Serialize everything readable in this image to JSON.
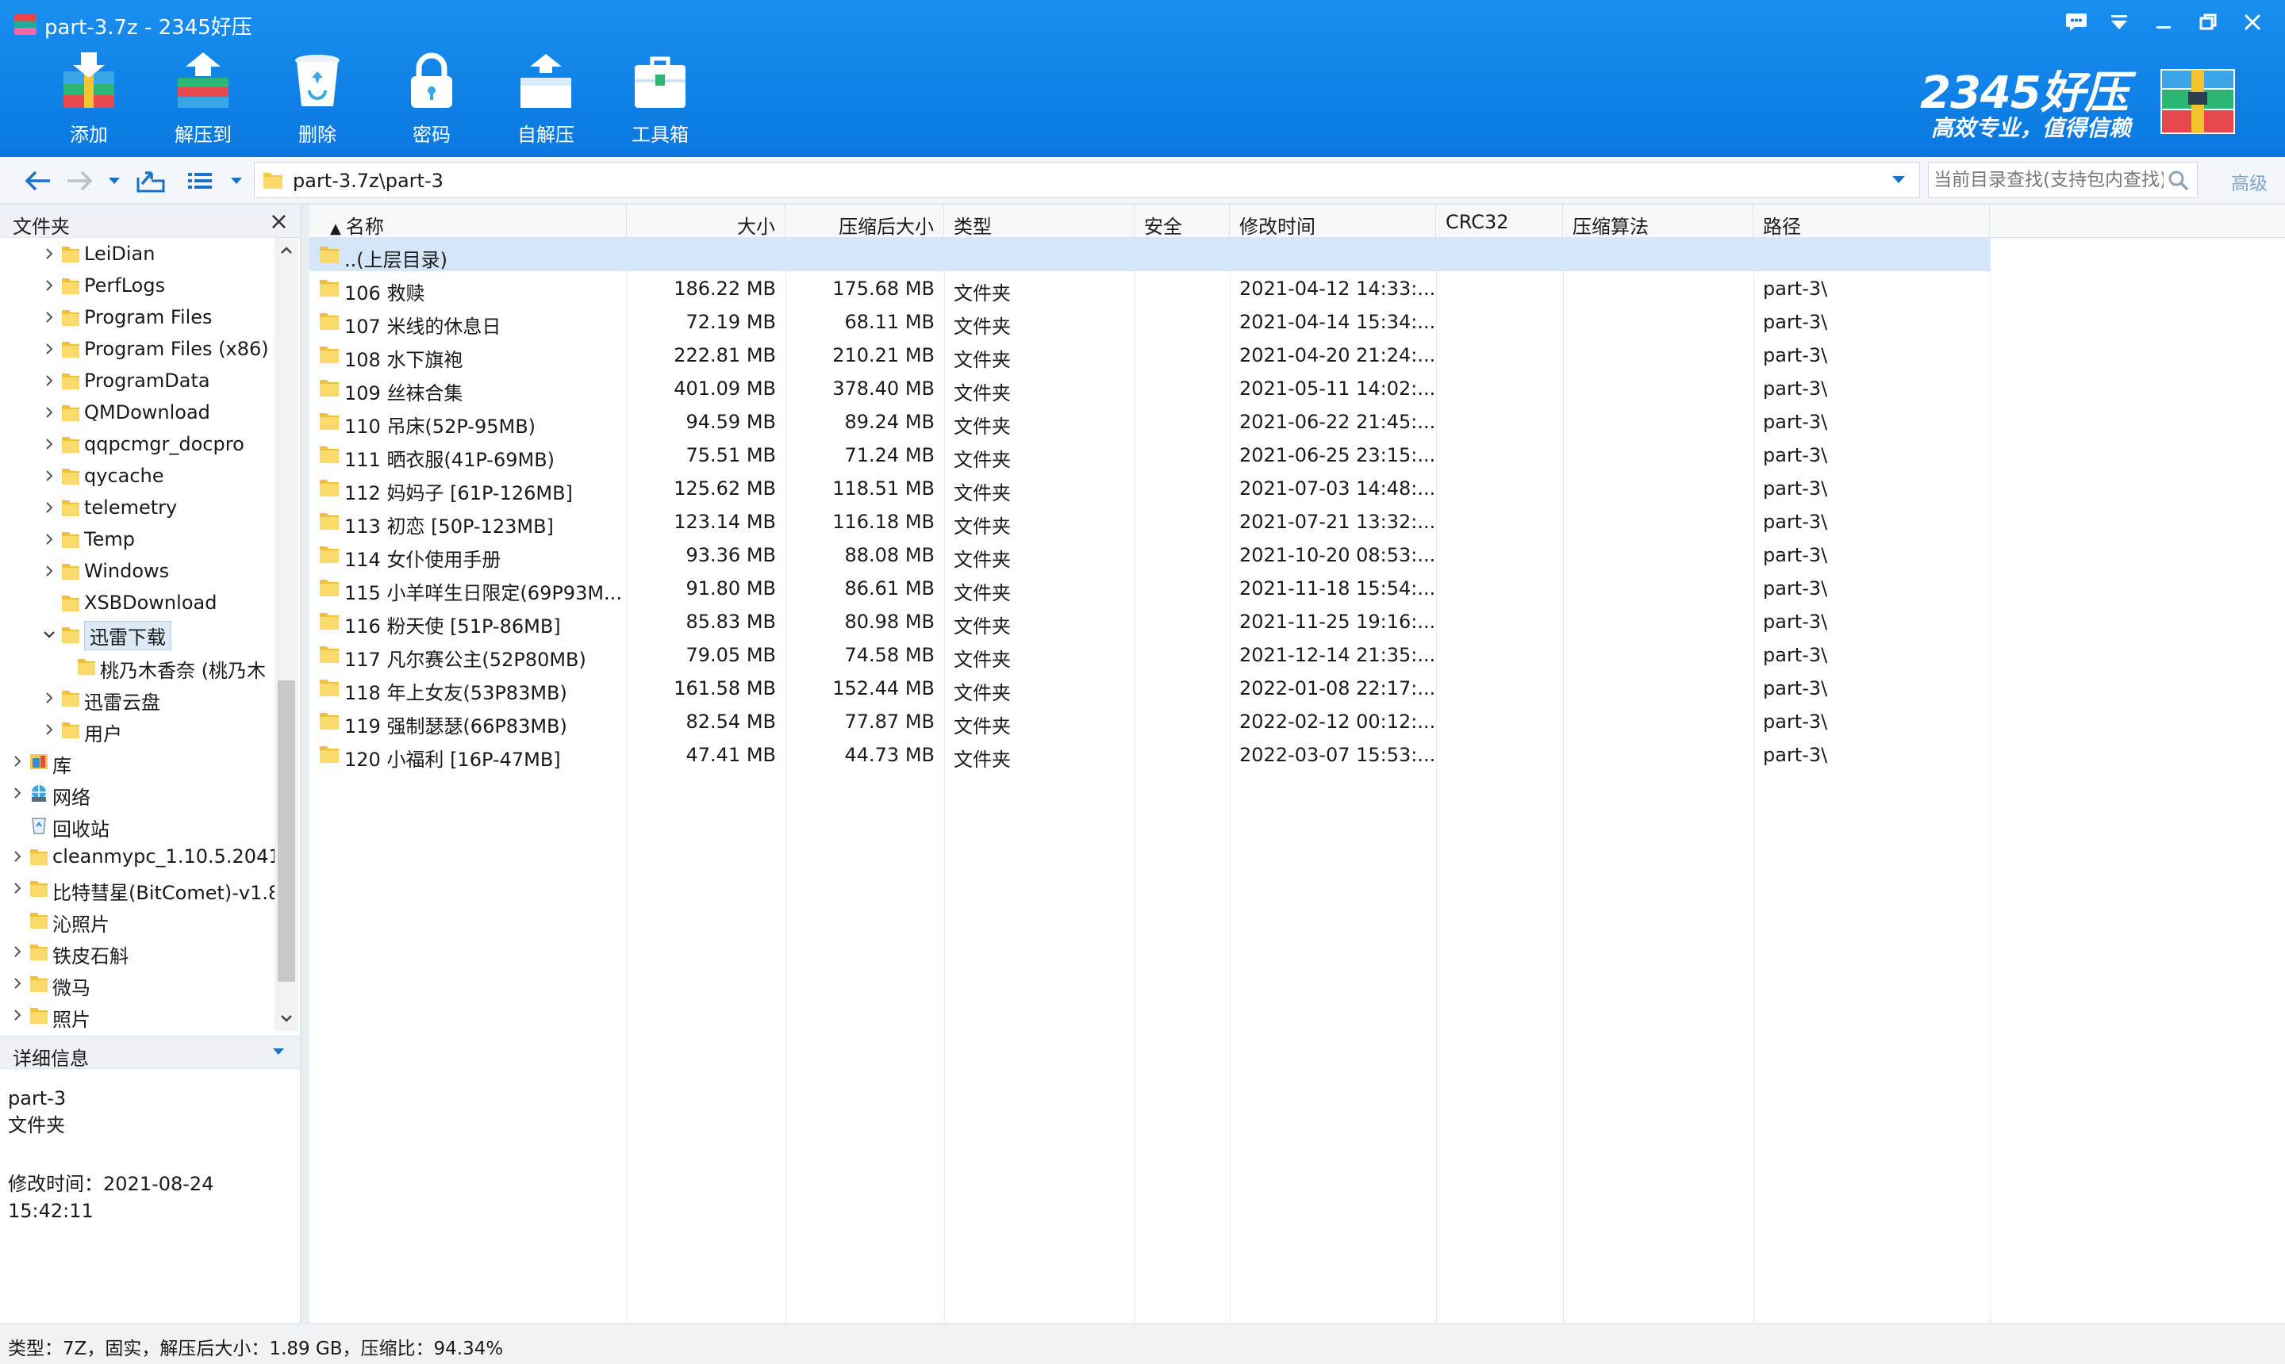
{
  "window": {
    "title": "part-3.7z - 2345好压"
  },
  "toolbar": {
    "buttons": [
      {
        "label": "添加",
        "icon": "add-archive-icon"
      },
      {
        "label": "解压到",
        "icon": "extract-to-icon"
      },
      {
        "label": "删除",
        "icon": "delete-bin-icon"
      },
      {
        "label": "密码",
        "icon": "padlock-icon"
      },
      {
        "label": "自解压",
        "icon": "self-extract-icon"
      },
      {
        "label": "工具箱",
        "icon": "toolbox-icon"
      }
    ]
  },
  "brand": {
    "name": "2345好压",
    "slogan": "高效专业，值得信赖"
  },
  "address": {
    "path": "part-3.7z\\part-3",
    "search_placeholder": "当前目录查找(支持包内查找)",
    "advanced_label": "高级"
  },
  "folder_pane": {
    "title": "文件夹",
    "close": "×",
    "tree": [
      {
        "label": "LeiDian",
        "level": 1,
        "expandable": true,
        "icon": "folder"
      },
      {
        "label": "PerfLogs",
        "level": 1,
        "expandable": true,
        "icon": "folder"
      },
      {
        "label": "Program Files",
        "level": 1,
        "expandable": true,
        "icon": "folder"
      },
      {
        "label": "Program Files (x86)",
        "level": 1,
        "expandable": true,
        "icon": "folder"
      },
      {
        "label": "ProgramData",
        "level": 1,
        "expandable": true,
        "icon": "folder"
      },
      {
        "label": "QMDownload",
        "level": 1,
        "expandable": true,
        "icon": "folder"
      },
      {
        "label": "qqpcmgr_docpro",
        "level": 1,
        "expandable": true,
        "icon": "folder"
      },
      {
        "label": "qycache",
        "level": 1,
        "expandable": true,
        "icon": "folder"
      },
      {
        "label": "telemetry",
        "level": 1,
        "expandable": true,
        "icon": "folder"
      },
      {
        "label": "Temp",
        "level": 1,
        "expandable": true,
        "icon": "folder"
      },
      {
        "label": "Windows",
        "level": 1,
        "expandable": true,
        "icon": "folder"
      },
      {
        "label": "XSBDownload",
        "level": 1,
        "expandable": false,
        "icon": "folder"
      },
      {
        "label": "迅雷下载",
        "level": 1,
        "expandable": true,
        "expanded": true,
        "selected": true,
        "icon": "folder"
      },
      {
        "label": "桃乃木香奈 (桃乃木",
        "level": 2,
        "expandable": false,
        "icon": "folder"
      },
      {
        "label": "迅雷云盘",
        "level": 1,
        "expandable": true,
        "icon": "folder"
      },
      {
        "label": "用户",
        "level": 1,
        "expandable": true,
        "icon": "folder"
      },
      {
        "label": "库",
        "level": 0,
        "expandable": true,
        "icon": "library"
      },
      {
        "label": "网络",
        "level": 0,
        "expandable": true,
        "icon": "network"
      },
      {
        "label": "回收站",
        "level": 0,
        "expandable": false,
        "icon": "recycle"
      },
      {
        "label": "cleanmypc_1.10.5.2041",
        "level": 0,
        "expandable": true,
        "icon": "folder"
      },
      {
        "label": "比特彗星(BitComet)-v1.8",
        "level": 0,
        "expandable": true,
        "icon": "folder"
      },
      {
        "label": "沁照片",
        "level": 0,
        "expandable": false,
        "icon": "folder"
      },
      {
        "label": "铁皮石斛",
        "level": 0,
        "expandable": true,
        "icon": "folder"
      },
      {
        "label": "微马",
        "level": 0,
        "expandable": true,
        "icon": "folder"
      },
      {
        "label": "照片",
        "level": 0,
        "expandable": true,
        "icon": "folder"
      }
    ]
  },
  "details": {
    "title": "详细信息",
    "name": "part-3",
    "type": "文件夹",
    "modified": "修改时间：2021-08-24 15:42:11"
  },
  "columns": [
    {
      "key": "name",
      "label": "名称"
    },
    {
      "key": "size",
      "label": "大小"
    },
    {
      "key": "packed",
      "label": "压缩后大小"
    },
    {
      "key": "type",
      "label": "类型"
    },
    {
      "key": "security",
      "label": "安全"
    },
    {
      "key": "modified",
      "label": "修改时间"
    },
    {
      "key": "crc",
      "label": "CRC32"
    },
    {
      "key": "method",
      "label": "压缩算法"
    },
    {
      "key": "path",
      "label": "路径"
    }
  ],
  "files": [
    {
      "name": "..(上层目录)",
      "size": "",
      "packed": "",
      "type": "",
      "modified": "",
      "path": "",
      "up": true
    },
    {
      "name": "106  救赎",
      "size": "186.22 MB",
      "packed": "175.68 MB",
      "type": "文件夹",
      "modified": "2021-04-12 14:33:...",
      "path": "part-3\\"
    },
    {
      "name": "107  米线的休息日",
      "size": "72.19 MB",
      "packed": "68.11 MB",
      "type": "文件夹",
      "modified": "2021-04-14 15:34:...",
      "path": "part-3\\"
    },
    {
      "name": "108  水下旗袍",
      "size": "222.81 MB",
      "packed": "210.21 MB",
      "type": "文件夹",
      "modified": "2021-04-20 21:24:...",
      "path": "part-3\\"
    },
    {
      "name": "109  丝袜合集",
      "size": "401.09 MB",
      "packed": "378.40 MB",
      "type": "文件夹",
      "modified": "2021-05-11 14:02:...",
      "path": "part-3\\"
    },
    {
      "name": "110  吊床(52P-95MB)",
      "size": "94.59 MB",
      "packed": "89.24 MB",
      "type": "文件夹",
      "modified": "2021-06-22 21:45:...",
      "path": "part-3\\"
    },
    {
      "name": "111  晒衣服(41P-69MB)",
      "size": "75.51 MB",
      "packed": "71.24 MB",
      "type": "文件夹",
      "modified": "2021-06-25 23:15:...",
      "path": "part-3\\"
    },
    {
      "name": "112  妈妈子 [61P-126MB]",
      "size": "125.62 MB",
      "packed": "118.51 MB",
      "type": "文件夹",
      "modified": "2021-07-03 14:48:...",
      "path": "part-3\\"
    },
    {
      "name": "113  初恋 [50P-123MB]",
      "size": "123.14 MB",
      "packed": "116.18 MB",
      "type": "文件夹",
      "modified": "2021-07-21 13:32:...",
      "path": "part-3\\"
    },
    {
      "name": "114  女仆使用手册",
      "size": "93.36 MB",
      "packed": "88.08 MB",
      "type": "文件夹",
      "modified": "2021-10-20 08:53:...",
      "path": "part-3\\"
    },
    {
      "name": "115  小羊咩生日限定(69P93M...",
      "size": "91.80 MB",
      "packed": "86.61 MB",
      "type": "文件夹",
      "modified": "2021-11-18 15:54:...",
      "path": "part-3\\"
    },
    {
      "name": "116  粉天使 [51P-86MB]",
      "size": "85.83 MB",
      "packed": "80.98 MB",
      "type": "文件夹",
      "modified": "2021-11-25 19:16:...",
      "path": "part-3\\"
    },
    {
      "name": "117  凡尔赛公主(52P80MB)",
      "size": "79.05 MB",
      "packed": "74.58 MB",
      "type": "文件夹",
      "modified": "2021-12-14 21:35:...",
      "path": "part-3\\"
    },
    {
      "name": "118  年上女友(53P83MB)",
      "size": "161.58 MB",
      "packed": "152.44 MB",
      "type": "文件夹",
      "modified": "2022-01-08 22:17:...",
      "path": "part-3\\"
    },
    {
      "name": "119  强制瑟瑟(66P83MB)",
      "size": "82.54 MB",
      "packed": "77.87 MB",
      "type": "文件夹",
      "modified": "2022-02-12 00:12:...",
      "path": "part-3\\"
    },
    {
      "name": "120  小福利 [16P-47MB]",
      "size": "47.41 MB",
      "packed": "44.73 MB",
      "type": "文件夹",
      "modified": "2022-03-07 15:53:...",
      "path": "part-3\\"
    }
  ],
  "status": {
    "text": "类型：7Z，固实，解压后大小：1.89 GB，压缩比：94.34%"
  },
  "colors": {
    "toolbar_blue": "#0a78e0",
    "selection": "#d4e6f8",
    "folder_yellow": "#f7c948"
  }
}
